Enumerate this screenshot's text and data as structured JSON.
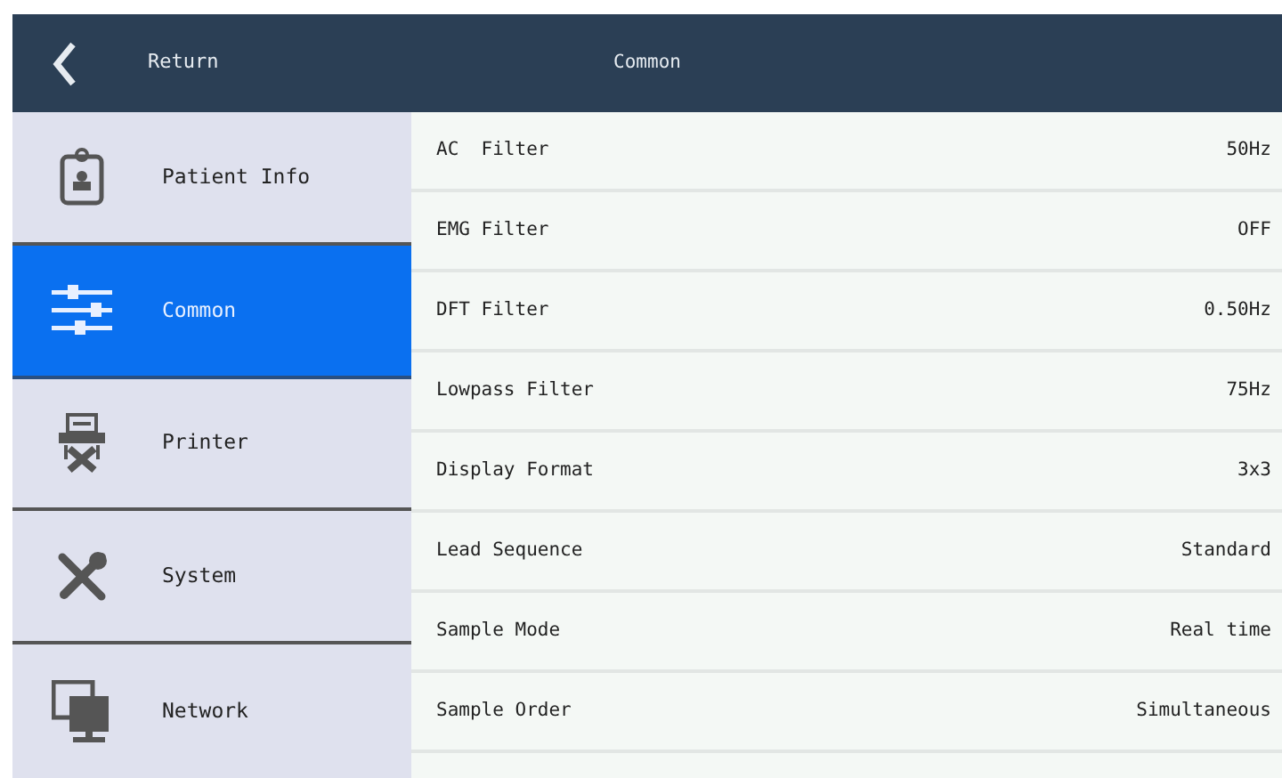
{
  "header": {
    "back_label": "Return",
    "title": "Common"
  },
  "sidebar": {
    "items": [
      {
        "label": "Patient Info",
        "selected": false
      },
      {
        "label": "Common",
        "selected": true
      },
      {
        "label": "Printer",
        "selected": false
      },
      {
        "label": "System",
        "selected": false
      },
      {
        "label": "Network",
        "selected": false
      }
    ]
  },
  "settings": [
    {
      "label": "AC  Filter",
      "value": "50Hz"
    },
    {
      "label": "EMG Filter",
      "value": "OFF"
    },
    {
      "label": "DFT Filter",
      "value": "0.50Hz"
    },
    {
      "label": "Lowpass Filter",
      "value": "75Hz"
    },
    {
      "label": "Display Format",
      "value": "3x3"
    },
    {
      "label": "Lead Sequence",
      "value": "Standard"
    },
    {
      "label": "Sample Mode",
      "value": "Real time"
    },
    {
      "label": "Sample Order",
      "value": "Simultaneous"
    }
  ]
}
